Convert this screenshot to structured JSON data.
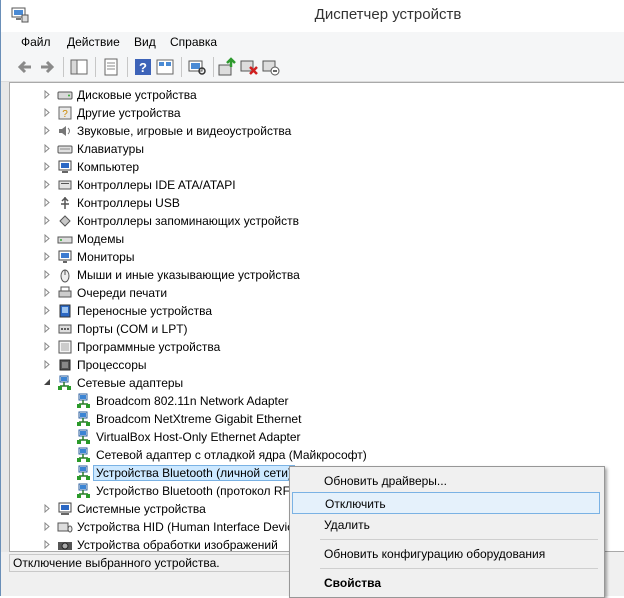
{
  "window": {
    "title": "Диспетчер устройств"
  },
  "menu": [
    "Файл",
    "Действие",
    "Вид",
    "Справка"
  ],
  "toolbar": [
    "back-icon",
    "forward-icon",
    "show-hide-console-tree-icon",
    "properties-icon",
    "help-icon",
    "view-icon",
    "scan-hardware-icon",
    "update-driver-icon",
    "uninstall-icon",
    "disable-icon"
  ],
  "tree": [
    {
      "label": "Дисковые устройства",
      "icon": "disk-drive-icon",
      "level": 0,
      "expanded": false
    },
    {
      "label": "Другие устройства",
      "icon": "other-devices-icon",
      "level": 0,
      "expanded": false
    },
    {
      "label": "Звуковые, игровые и видеоустройства",
      "icon": "speaker-icon",
      "level": 0,
      "expanded": false
    },
    {
      "label": "Клавиатуры",
      "icon": "keyboard-icon",
      "level": 0,
      "expanded": false
    },
    {
      "label": "Компьютер",
      "icon": "computer-icon",
      "level": 0,
      "expanded": false
    },
    {
      "label": "Контроллеры IDE ATA/ATAPI",
      "icon": "ide-controller-icon",
      "level": 0,
      "expanded": false
    },
    {
      "label": "Контроллеры USB",
      "icon": "usb-icon",
      "level": 0,
      "expanded": false
    },
    {
      "label": "Контроллеры запоминающих устройств",
      "icon": "storage-controller-icon",
      "level": 0,
      "expanded": false
    },
    {
      "label": "Модемы",
      "icon": "modem-icon",
      "level": 0,
      "expanded": false
    },
    {
      "label": "Мониторы",
      "icon": "monitor-icon",
      "level": 0,
      "expanded": false
    },
    {
      "label": "Мыши и иные указывающие устройства",
      "icon": "mouse-icon",
      "level": 0,
      "expanded": false
    },
    {
      "label": "Очереди печати",
      "icon": "printer-icon",
      "level": 0,
      "expanded": false
    },
    {
      "label": "Переносные устройства",
      "icon": "portable-device-icon",
      "level": 0,
      "expanded": false
    },
    {
      "label": "Порты (COM и LPT)",
      "icon": "port-icon",
      "level": 0,
      "expanded": false
    },
    {
      "label": "Программные устройства",
      "icon": "software-device-icon",
      "level": 0,
      "expanded": false
    },
    {
      "label": "Процессоры",
      "icon": "processor-icon",
      "level": 0,
      "expanded": false
    },
    {
      "label": "Сетевые адаптеры",
      "icon": "network-adapter-icon",
      "level": 0,
      "expanded": true
    },
    {
      "label": "Broadcom 802.11n Network Adapter",
      "icon": "network-adapter-icon",
      "level": 1
    },
    {
      "label": "Broadcom NetXtreme Gigabit Ethernet",
      "icon": "network-adapter-icon",
      "level": 1
    },
    {
      "label": "VirtualBox Host-Only Ethernet Adapter",
      "icon": "network-adapter-icon",
      "level": 1
    },
    {
      "label": "Сетевой адаптер с отладкой ядра (Майкрософт)",
      "icon": "network-adapter-icon",
      "level": 1
    },
    {
      "label": "Устройства Bluetooth (личной сети)",
      "icon": "network-adapter-icon",
      "level": 1,
      "selected": true
    },
    {
      "label": "Устройство Bluetooth (протокол RFCOMM TDI)",
      "icon": "network-adapter-icon",
      "level": 1
    },
    {
      "label": "Системные устройства",
      "icon": "system-device-icon",
      "level": 0,
      "expanded": false
    },
    {
      "label": "Устройства HID (Human Interface Devices)",
      "icon": "hid-icon",
      "level": 0,
      "expanded": false
    },
    {
      "label": "Устройства обработки изображений",
      "icon": "camera-icon",
      "level": 0,
      "expanded": false
    }
  ],
  "status": {
    "text": "Отключение выбранного устройства."
  },
  "context_menu": {
    "items": [
      {
        "label": "Обновить драйверы..."
      },
      {
        "label": "Отключить",
        "highlighted": true
      },
      {
        "label": "Удалить"
      },
      {
        "label": "Обновить конфигурацию оборудования"
      },
      {
        "label": "Свойства",
        "bold": true
      }
    ]
  }
}
